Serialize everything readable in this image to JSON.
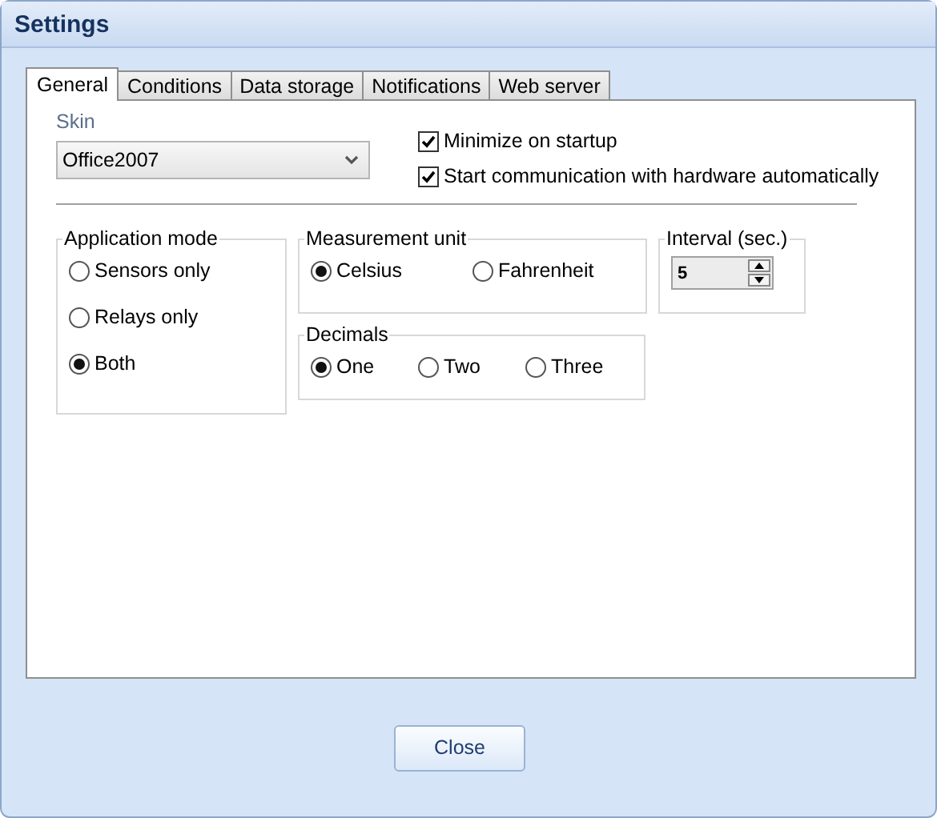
{
  "window": {
    "title": "Settings"
  },
  "tabs": [
    {
      "label": "General",
      "selected": true
    },
    {
      "label": "Conditions",
      "selected": false
    },
    {
      "label": "Data storage",
      "selected": false
    },
    {
      "label": "Notifications",
      "selected": false
    },
    {
      "label": "Web server",
      "selected": false
    }
  ],
  "skin": {
    "label": "Skin",
    "value": "Office2007"
  },
  "options": [
    {
      "label": "Minimize on startup",
      "checked": true
    },
    {
      "label": "Start communication with hardware automatically",
      "checked": true
    }
  ],
  "application_mode": {
    "title": "Application mode",
    "items": [
      {
        "label": "Sensors only",
        "selected": false
      },
      {
        "label": "Relays only",
        "selected": false
      },
      {
        "label": "Both",
        "selected": true
      }
    ]
  },
  "measurement_unit": {
    "title": "Measurement unit",
    "items": [
      {
        "label": "Celsius",
        "selected": true
      },
      {
        "label": "Fahrenheit",
        "selected": false
      }
    ]
  },
  "decimals": {
    "title": "Decimals",
    "items": [
      {
        "label": "One",
        "selected": true
      },
      {
        "label": "Two",
        "selected": false
      },
      {
        "label": "Three",
        "selected": false
      }
    ]
  },
  "interval": {
    "title": "Interval (sec.)",
    "value": "5"
  },
  "buttons": [
    {
      "label": "Close"
    }
  ]
}
